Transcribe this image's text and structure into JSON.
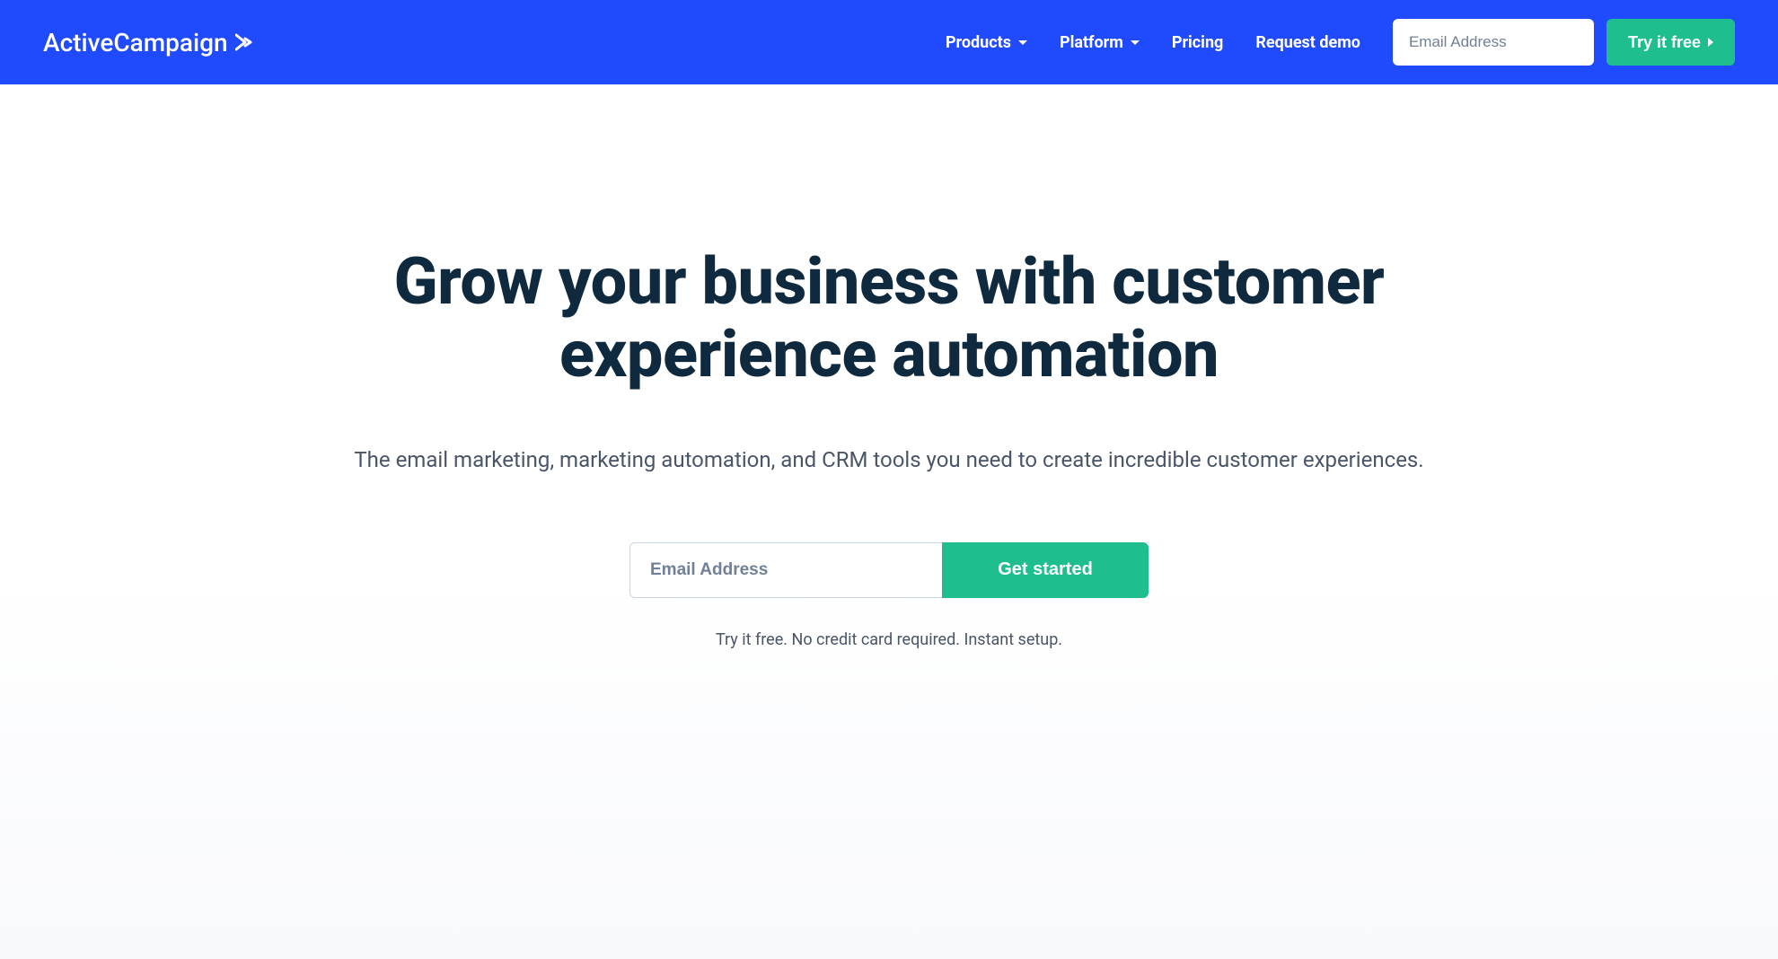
{
  "header": {
    "logo_text": "ActiveCampaign",
    "nav": {
      "products": "Products",
      "platform": "Platform",
      "pricing": "Pricing",
      "request_demo": "Request demo"
    },
    "email_placeholder": "Email Address",
    "try_free_label": "Try it free"
  },
  "hero": {
    "title": "Grow your business with customer experience automation",
    "subtitle": "The email marketing, marketing automation, and CRM tools you need to create incredible customer experiences.",
    "email_placeholder": "Email Address",
    "get_started_label": "Get started",
    "disclaimer": "Try it free. No credit card required. Instant setup."
  }
}
